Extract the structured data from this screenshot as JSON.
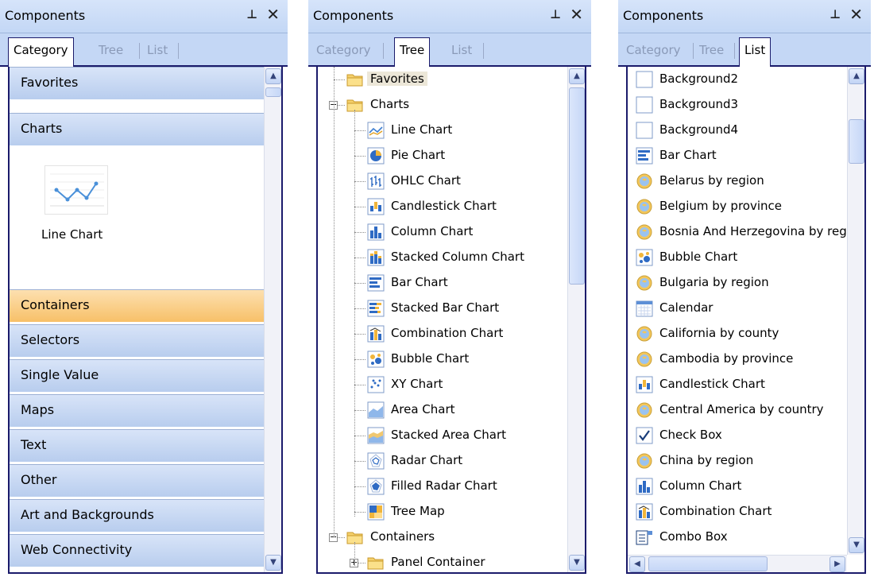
{
  "panel_title": "Components",
  "tabs": [
    "Category",
    "Tree",
    "List"
  ],
  "category_panel": {
    "categories": [
      "Favorites",
      "Charts",
      "Containers",
      "Selectors",
      "Single Value",
      "Maps",
      "Text",
      "Other",
      "Art and Backgrounds",
      "Web Connectivity"
    ],
    "highlighted": "Containers",
    "charts_items": [
      {
        "label": "Line Chart"
      }
    ]
  },
  "tree_panel": {
    "rows": [
      {
        "label": "Favorites",
        "level": 0,
        "icon": "folder-icon",
        "expander": "",
        "selected": true
      },
      {
        "label": "Charts",
        "level": 0,
        "icon": "folder-icon",
        "expander": "minus"
      },
      {
        "label": "Line Chart",
        "level": 1,
        "icon": "line-chart-icon"
      },
      {
        "label": "Pie Chart",
        "level": 1,
        "icon": "pie-chart-icon"
      },
      {
        "label": "OHLC Chart",
        "level": 1,
        "icon": "ohlc-chart-icon"
      },
      {
        "label": "Candlestick Chart",
        "level": 1,
        "icon": "candlestick-chart-icon"
      },
      {
        "label": "Column Chart",
        "level": 1,
        "icon": "column-chart-icon"
      },
      {
        "label": "Stacked Column Chart",
        "level": 1,
        "icon": "stacked-column-chart-icon"
      },
      {
        "label": "Bar Chart",
        "level": 1,
        "icon": "bar-chart-icon"
      },
      {
        "label": "Stacked Bar Chart",
        "level": 1,
        "icon": "stacked-bar-chart-icon"
      },
      {
        "label": "Combination Chart",
        "level": 1,
        "icon": "combination-chart-icon"
      },
      {
        "label": "Bubble Chart",
        "level": 1,
        "icon": "bubble-chart-icon"
      },
      {
        "label": "XY Chart",
        "level": 1,
        "icon": "xy-chart-icon"
      },
      {
        "label": "Area Chart",
        "level": 1,
        "icon": "area-chart-icon"
      },
      {
        "label": "Stacked Area Chart",
        "level": 1,
        "icon": "stacked-area-chart-icon"
      },
      {
        "label": "Radar Chart",
        "level": 1,
        "icon": "radar-chart-icon"
      },
      {
        "label": "Filled Radar Chart",
        "level": 1,
        "icon": "filled-radar-chart-icon"
      },
      {
        "label": "Tree Map",
        "level": 1,
        "icon": "tree-map-icon"
      },
      {
        "label": "Containers",
        "level": 0,
        "icon": "folder-icon",
        "expander": "minus"
      },
      {
        "label": "Panel Container",
        "level": 1,
        "icon": "folder-icon",
        "expander": "plus"
      }
    ]
  },
  "list_panel": {
    "items": [
      {
        "label": "Background2",
        "icon": "background-icon"
      },
      {
        "label": "Background3",
        "icon": "background-icon"
      },
      {
        "label": "Background4",
        "icon": "background-icon"
      },
      {
        "label": "Bar Chart",
        "icon": "bar-chart-icon"
      },
      {
        "label": "Belarus by region",
        "icon": "map-globe-icon"
      },
      {
        "label": "Belgium by province",
        "icon": "map-globe-icon"
      },
      {
        "label": "Bosnia And Herzegovina by regi",
        "icon": "map-globe-icon"
      },
      {
        "label": "Bubble Chart",
        "icon": "bubble-chart-icon"
      },
      {
        "label": "Bulgaria by region",
        "icon": "map-globe-icon"
      },
      {
        "label": "Calendar",
        "icon": "calendar-icon"
      },
      {
        "label": "California by county",
        "icon": "map-globe-icon"
      },
      {
        "label": "Cambodia by province",
        "icon": "map-globe-icon"
      },
      {
        "label": "Candlestick Chart",
        "icon": "candlestick-chart-icon"
      },
      {
        "label": "Central America by country",
        "icon": "map-globe-icon"
      },
      {
        "label": "Check Box",
        "icon": "check-box-icon"
      },
      {
        "label": "China by region",
        "icon": "map-globe-icon"
      },
      {
        "label": "Column Chart",
        "icon": "column-chart-icon"
      },
      {
        "label": "Combination Chart",
        "icon": "combination-chart-icon"
      },
      {
        "label": "Combo Box",
        "icon": "combo-box-icon"
      }
    ]
  },
  "colors": {
    "titlebar": "#c3d7f5",
    "tab_border": "#1b1b6b",
    "category_bar": "#b8cdee",
    "category_highlight": "#f7c068",
    "folder": "#f5d06b"
  }
}
